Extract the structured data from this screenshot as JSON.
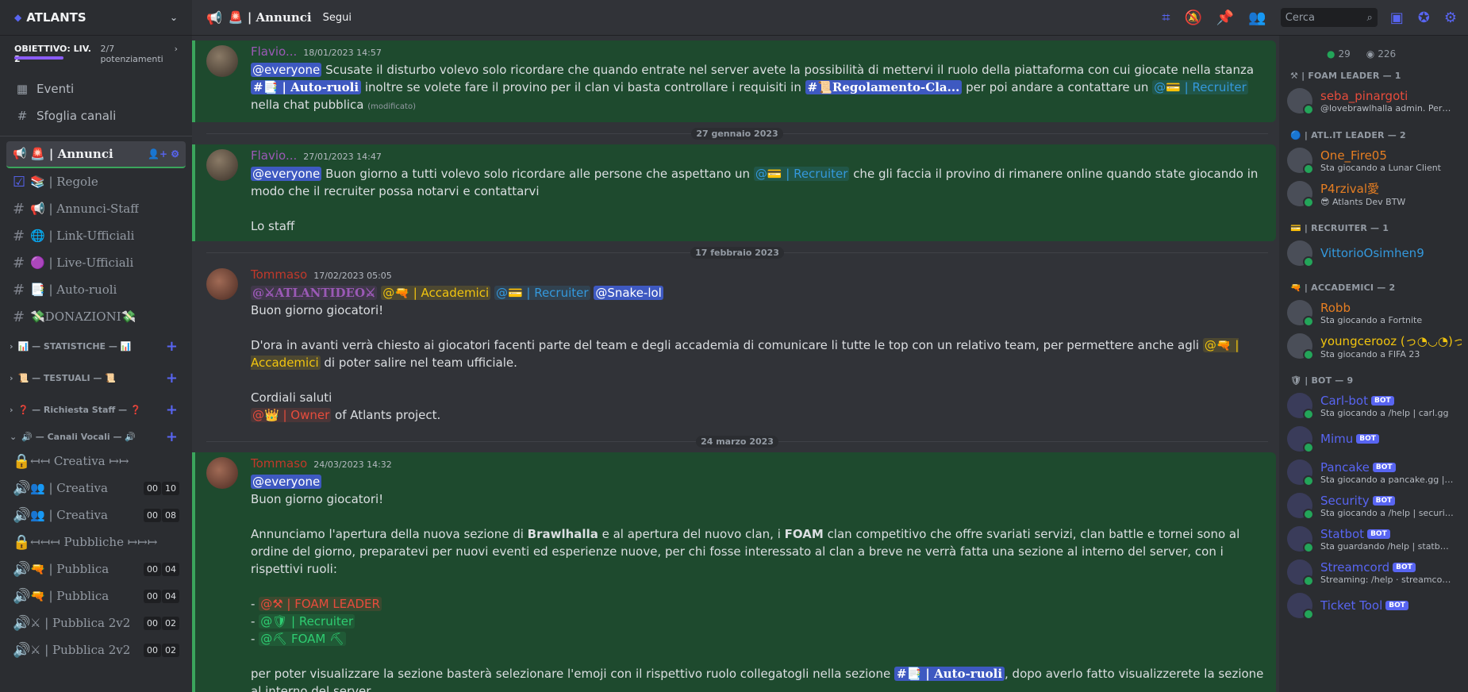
{
  "server": {
    "name": "ATLANTS",
    "boost_goal": "OBIETTIVO: LIV. 2",
    "boost_count": "2/7 potenziamenti"
  },
  "side_links": [
    {
      "icon": "calendar-icon",
      "label": "Eventi"
    },
    {
      "icon": "browse-channels-icon",
      "label": "Sfoglia canali"
    }
  ],
  "channels": [
    {
      "label": "🚨 | Annunci",
      "active": true
    },
    {
      "label": "📚 | Regole"
    },
    {
      "label": "📢 | Annunci-Staff"
    },
    {
      "label": "🌐 | Link-Ufficiali"
    },
    {
      "label": "🟣 | Live-Ufficiali"
    },
    {
      "label": "📑 | Auto-ruoli"
    },
    {
      "label": "💸DONAZIONI💸"
    }
  ],
  "categories": [
    {
      "label": "📊 — STATISTICHE — 📊"
    },
    {
      "label": "📜 — TESTUALI — 📜"
    },
    {
      "label": "❓ — Richiesta Staff — ❓"
    },
    {
      "label": "🔊 — Canali Vocali — 🔊"
    }
  ],
  "voice_channels": [
    {
      "label": "↤↤ Creativa ↦↦",
      "locked": true,
      "a": "",
      "b": ""
    },
    {
      "label": "👥 | Creativa",
      "a": "00",
      "b": "10"
    },
    {
      "label": "👥 | Creativa",
      "a": "00",
      "b": "08"
    },
    {
      "label": "↤↤↤ Pubbliche ↦↦↦",
      "locked": true,
      "a": "",
      "b": ""
    },
    {
      "label": "🔫 | Pubblica",
      "a": "00",
      "b": "04"
    },
    {
      "label": "🔫 | Pubblica",
      "a": "00",
      "b": "04"
    },
    {
      "label": "⚔ | Pubblica 2v2",
      "a": "00",
      "b": "02"
    },
    {
      "label": "⚔ | Pubblica 2v2",
      "a": "00",
      "b": "02"
    }
  ],
  "topbar": {
    "channel": "🚨 | Annunci",
    "follow": "Segui",
    "search_placeholder": "Cerca"
  },
  "messages": {
    "m1": {
      "author": "Flavio...",
      "time": "18/01/2023 14:57",
      "everyone": "@everyone",
      "t1": " Scusate il disturbo volevo solo ricordare che quando entrate nel server avete la possibilità di mettervi il ruolo della piattaforma con cui giocate nella stanza ",
      "ch1": "#📑 | Auto-ruoli",
      "t2": " inoltre se volete fare il provino per il clan vi basta controllare i requisiti in ",
      "ch2": "#📜Regolamento-Cla...",
      "t3": " per poi andare a contattare un ",
      "role": "@💳 | Recruiter",
      "t4": " nella chat pubblica ",
      "edited": "(modificato)"
    },
    "d1": "27 gennaio 2023",
    "m2": {
      "author": "Flavio...",
      "time": "27/01/2023 14:47",
      "everyone": "@everyone",
      "t1": " Buon giorno a tutti volevo solo ricordare alle persone che aspettano un ",
      "role": "@💳 | Recruiter",
      "t2": " che gli faccia il provino di rimanere online quando state giocando in modo che il recruiter possa notarvi e contattarvi",
      "t3": "Lo staff"
    },
    "d2": "17 febbraio 2023",
    "m3": {
      "author": "Tommaso",
      "time": "17/02/2023 05:05",
      "r1": "@⚔ATLANTIDEO⚔",
      "r2": "@🔫 | Accademici",
      "r3": "@💳 | Recruiter",
      "r4": "@Snake-lol",
      "t1": "Buon giorno giocatori!",
      "t2": "D'ora in avanti verrà chiesto ai giocatori facenti parte del team e degli accademia di comunicare li tutte le top con un relativo team, per permettere anche agli ",
      "r5": "@🔫 | Accademici",
      "t3": " di poter salire nel team ufficiale.",
      "t4": "Cordiali saluti",
      "r6": "@👑 | Owner",
      "t5": " of Atlants project."
    },
    "d3": "24 marzo 2023",
    "m4": {
      "author": "Tommaso",
      "time": "24/03/2023 14:32",
      "everyone": "@everyone",
      "t1": "Buon giorno giocatori!",
      "t2a": "Annunciamo l'apertura della nuova sezione di ",
      "b1": "Brawlhalla",
      "t2b": " e al apertura del nuovo clan, i ",
      "b2": "FOAM",
      "t2c": " clan competitivo che offre svariati servizi, clan battle e tornei sono al ordine del giorno, preparatevi per nuovi eventi ed esperienze nuove, per chi fosse interessato al clan a breve ne verrà fatta una sezione al interno del server, con i rispettivi ruoli:",
      "l1": "@⚒ | FOAM LEADER",
      "l2": "@🛡 | Recruiter",
      "l3": "@⛏ FOAM ⛏",
      "t3a": "per poter visualizzare la sezione basterà selezionare l'emoji con il rispettivo ruolo collegatogli nella sezione ",
      "ch": "#📑 | Auto-ruoli",
      "t3b": ", dopo averlo fatto visualizzerete la sezione al interno del server."
    }
  },
  "members": {
    "online": "29",
    "voice": "226",
    "groups": [
      {
        "title": "⚒ | FOAM LEADER — 1",
        "list": [
          {
            "name": "seba_pinargoti",
            "status": "@lovebrawlhalla admin. Pers...",
            "color": "#e74c3c"
          }
        ]
      },
      {
        "title": "🔵 | ATL.IT LEADER — 2",
        "list": [
          {
            "name": "One_Fire05",
            "status": "Sta giocando a Lunar Client",
            "color": "#e67e22"
          },
          {
            "name": "P4rzival愛",
            "status": "😎 Atlants Dev BTW",
            "color": "#e67e22"
          }
        ]
      },
      {
        "title": "💳 | RECRUITER — 1",
        "list": [
          {
            "name": "VittorioOsimhen9",
            "status": "",
            "color": "#3498db"
          }
        ]
      },
      {
        "title": "🔫 | ACCADEMICI — 2",
        "list": [
          {
            "name": "Robb",
            "status": "Sta giocando a Fortnite",
            "color": "#e67e22"
          },
          {
            "name": "youngcerooz (っ◔◡◔)っ",
            "status": "Sta giocando a FIFA 23",
            "color": "#f1c40f"
          }
        ]
      },
      {
        "title": "🛡 | BOT — 9",
        "list": [
          {
            "name": "Carl-bot",
            "status": "Sta giocando a /help | carl.gg",
            "color": "#5865f2",
            "bot": "BOT"
          },
          {
            "name": "Mimu",
            "status": "",
            "color": "#5865f2",
            "bot": "BOT"
          },
          {
            "name": "Pancake",
            "status": "Sta giocando a pancake.gg | p...",
            "color": "#5865f2",
            "bot": "BOT"
          },
          {
            "name": "Security",
            "status": "Sta giocando a /help | securit...",
            "color": "#5865f2",
            "bot": "BOT"
          },
          {
            "name": "Statbot",
            "status": "Sta guardando /help | statbot...",
            "color": "#5865f2",
            "bot": "BOT"
          },
          {
            "name": "Streamcord",
            "status": "Streaming: /help · streamcord...",
            "color": "#5865f2",
            "bot": "BOT"
          },
          {
            "name": "Ticket Tool",
            "status": "",
            "color": "#5865f2",
            "bot": "BOT"
          }
        ]
      }
    ]
  },
  "colors": {
    "accent": "#5865f2",
    "highlight_bg": "#1e4a2e",
    "highlight_border": "#3ba55c"
  }
}
